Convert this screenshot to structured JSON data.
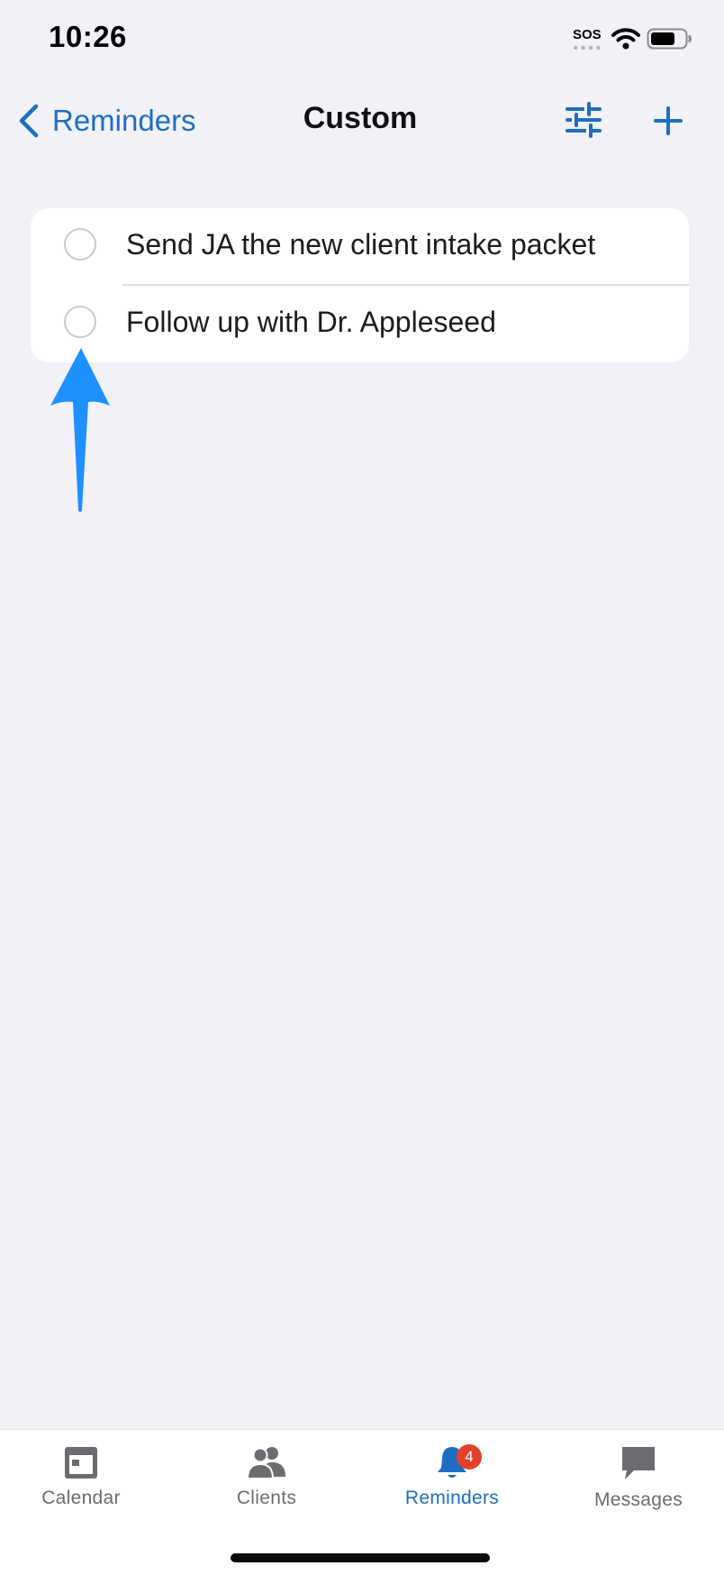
{
  "status_bar": {
    "time": "10:26",
    "sos": "SOS"
  },
  "nav": {
    "back_label": "Reminders",
    "title": "Custom"
  },
  "reminders": [
    {
      "text": "Send JA the new client intake packet",
      "completed": false
    },
    {
      "text": "Follow up with Dr. Appleseed",
      "completed": false
    }
  ],
  "tabbar": {
    "tabs": [
      {
        "label": "Calendar",
        "icon": "calendar-icon",
        "active": false
      },
      {
        "label": "Clients",
        "icon": "people-icon",
        "active": false
      },
      {
        "label": "Reminders",
        "icon": "bell-icon",
        "active": true,
        "badge": "4"
      },
      {
        "label": "Messages",
        "icon": "chat-bubble-icon",
        "active": false
      }
    ]
  },
  "colors": {
    "accent": "#1d6ec2",
    "background": "#f1f1f7",
    "badge": "#e2402b",
    "annotation_arrow": "#1e90ff"
  }
}
